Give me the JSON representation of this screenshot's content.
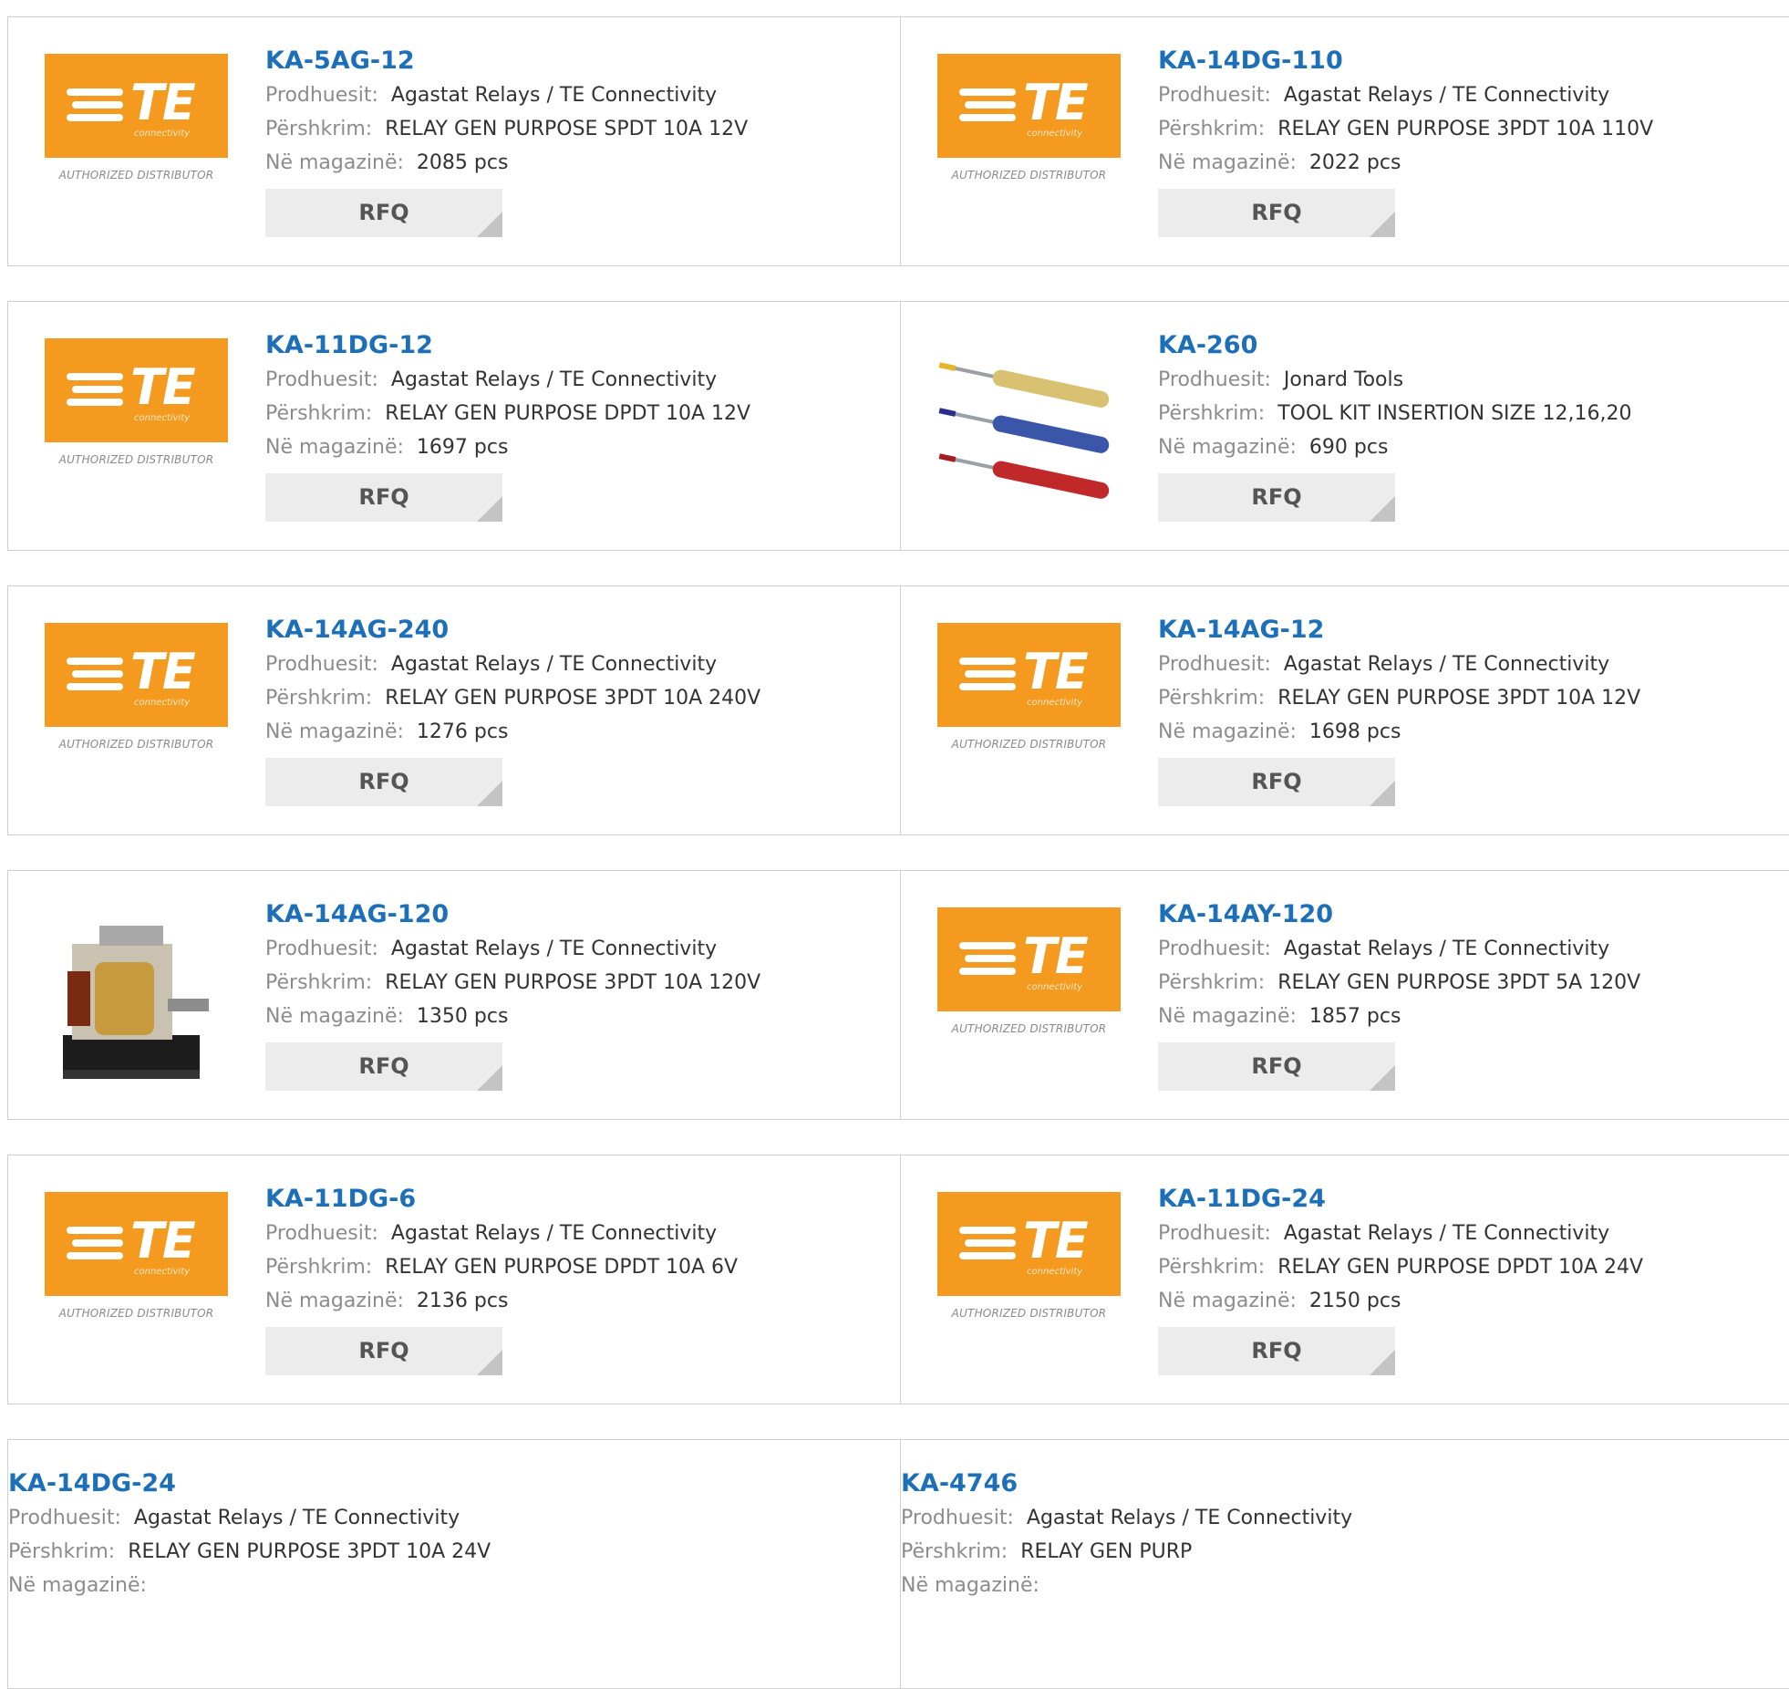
{
  "labels": {
    "manufacturer": "Prodhuesit:",
    "description": "Përshkrim:",
    "stock": "Në magazinë:",
    "rfq": "RFQ"
  },
  "te_logo": {
    "letters": "TE",
    "sub": "connectivity",
    "distributor": "AUTHORIZED DISTRIBUTOR",
    "color": "#f39a1f"
  },
  "products": [
    {
      "part": "KA-5AG-12",
      "manufacturer": "Agastat Relays / TE Connectivity",
      "description": "RELAY GEN PURPOSE SPDT 10A 12V",
      "stock": "2085 pcs",
      "image": "te-logo"
    },
    {
      "part": "KA-14DG-110",
      "manufacturer": "Agastat Relays / TE Connectivity",
      "description": "RELAY GEN PURPOSE 3PDT 10A 110V",
      "stock": "2022 pcs",
      "image": "te-logo"
    },
    {
      "part": "KA-11DG-12",
      "manufacturer": "Agastat Relays / TE Connectivity",
      "description": "RELAY GEN PURPOSE DPDT 10A 12V",
      "stock": "1697 pcs",
      "image": "te-logo"
    },
    {
      "part": "KA-260",
      "manufacturer": "Jonard Tools",
      "description": "TOOL KIT INSERTION SIZE 12,16,20",
      "stock": "690 pcs",
      "image": "tool-kit"
    },
    {
      "part": "KA-14AG-240",
      "manufacturer": "Agastat Relays / TE Connectivity",
      "description": "RELAY GEN PURPOSE 3PDT 10A 240V",
      "stock": "1276 pcs",
      "image": "te-logo"
    },
    {
      "part": "KA-14AG-12",
      "manufacturer": "Agastat Relays / TE Connectivity",
      "description": "RELAY GEN PURPOSE 3PDT 10A 12V",
      "stock": "1698 pcs",
      "image": "te-logo"
    },
    {
      "part": "KA-14AG-120",
      "manufacturer": "Agastat Relays / TE Connectivity",
      "description": "RELAY GEN PURPOSE 3PDT 10A 120V",
      "stock": "1350 pcs",
      "image": "relay"
    },
    {
      "part": "KA-14AY-120",
      "manufacturer": "Agastat Relays / TE Connectivity",
      "description": "RELAY GEN PURPOSE 3PDT 5A 120V",
      "stock": "1857 pcs",
      "image": "te-logo"
    },
    {
      "part": "KA-11DG-6",
      "manufacturer": "Agastat Relays / TE Connectivity",
      "description": "RELAY GEN PURPOSE DPDT 10A 6V",
      "stock": "2136 pcs",
      "image": "te-logo"
    },
    {
      "part": "KA-11DG-24",
      "manufacturer": "Agastat Relays / TE Connectivity",
      "description": "RELAY GEN PURPOSE DPDT 10A 24V",
      "stock": "2150 pcs",
      "image": "te-logo"
    },
    {
      "part": "KA-14DG-24",
      "manufacturer": "Agastat Relays / TE Connectivity",
      "description": "RELAY GEN PURPOSE 3PDT 10A 24V",
      "stock": "",
      "image": "none"
    },
    {
      "part": "KA-4746",
      "manufacturer": "Agastat Relays / TE Connectivity",
      "description": "RELAY GEN PURP",
      "stock": "",
      "image": "none"
    }
  ]
}
